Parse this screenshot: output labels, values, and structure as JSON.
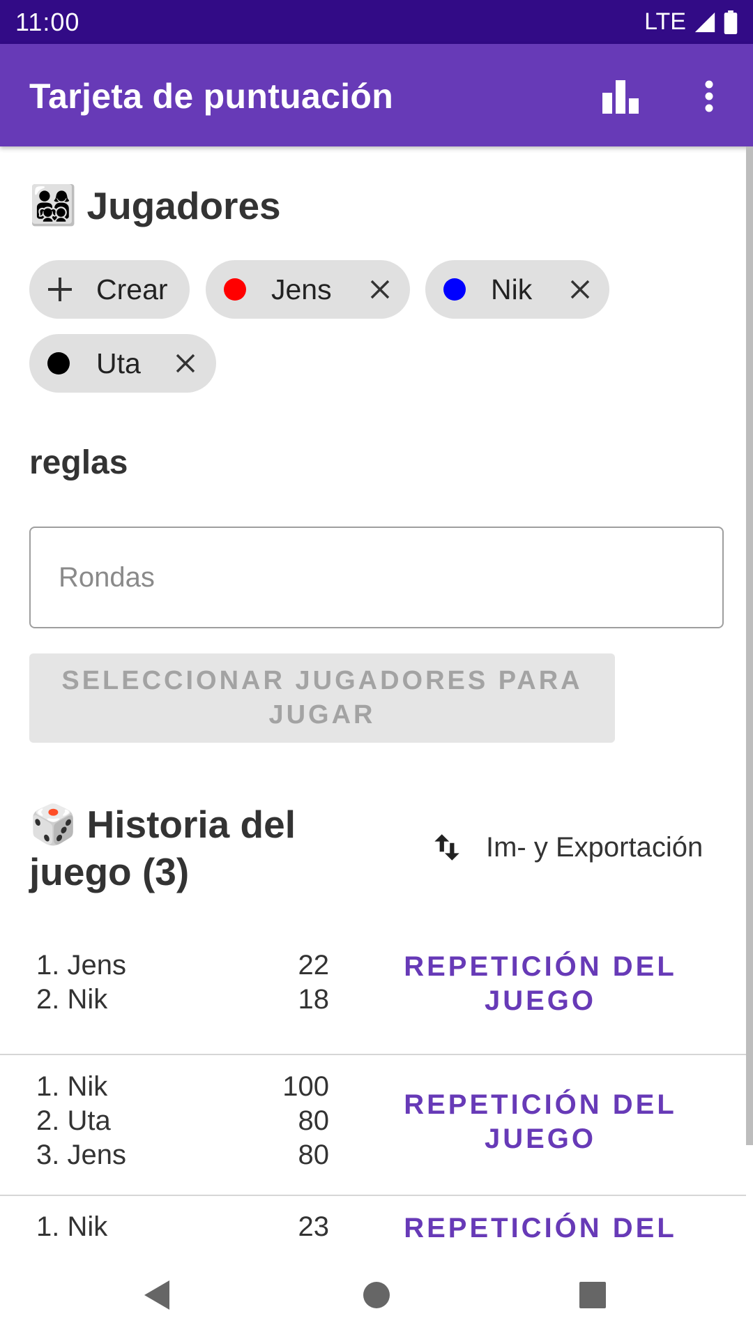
{
  "status_bar": {
    "time": "11:00",
    "network": "LTE"
  },
  "app_bar": {
    "title": "Tarjeta de puntuación",
    "stats_icon": "bar-chart-icon",
    "more_icon": "more-vert-icon"
  },
  "players_section": {
    "emoji": "👨‍👩‍👧‍👦",
    "title": "Jugadores",
    "create_chip": "Crear",
    "players": [
      {
        "name": "Jens",
        "color": "#ff0000"
      },
      {
        "name": "Nik",
        "color": "#0000ff"
      },
      {
        "name": "Uta",
        "color": "#000000"
      }
    ]
  },
  "rules_section": {
    "title": "reglas",
    "rounds_placeholder": "Rondas",
    "rounds_value": ""
  },
  "select_button": {
    "label": "SELECCIONAR JUGADORES PARA JUGAR"
  },
  "history_section": {
    "emoji": "🎲",
    "title": "Historia del juego (3)",
    "import_export_label": "Im- y Exportación",
    "replay_label": "REPETICIÓN DEL JUEGO",
    "games": [
      {
        "results": [
          {
            "rank": "1. Jens",
            "score": "22"
          },
          {
            "rank": "2. Nik",
            "score": "18"
          }
        ]
      },
      {
        "results": [
          {
            "rank": "1. Nik",
            "score": "100"
          },
          {
            "rank": "2. Uta",
            "score": "80"
          },
          {
            "rank": "3. Jens",
            "score": "80"
          }
        ]
      },
      {
        "results": [
          {
            "rank": "1. Nik",
            "score": "23"
          }
        ]
      }
    ]
  },
  "colors": {
    "primary": "#673ab7",
    "primary_dark": "#320b86",
    "chip_bg": "#e0e0e0"
  }
}
